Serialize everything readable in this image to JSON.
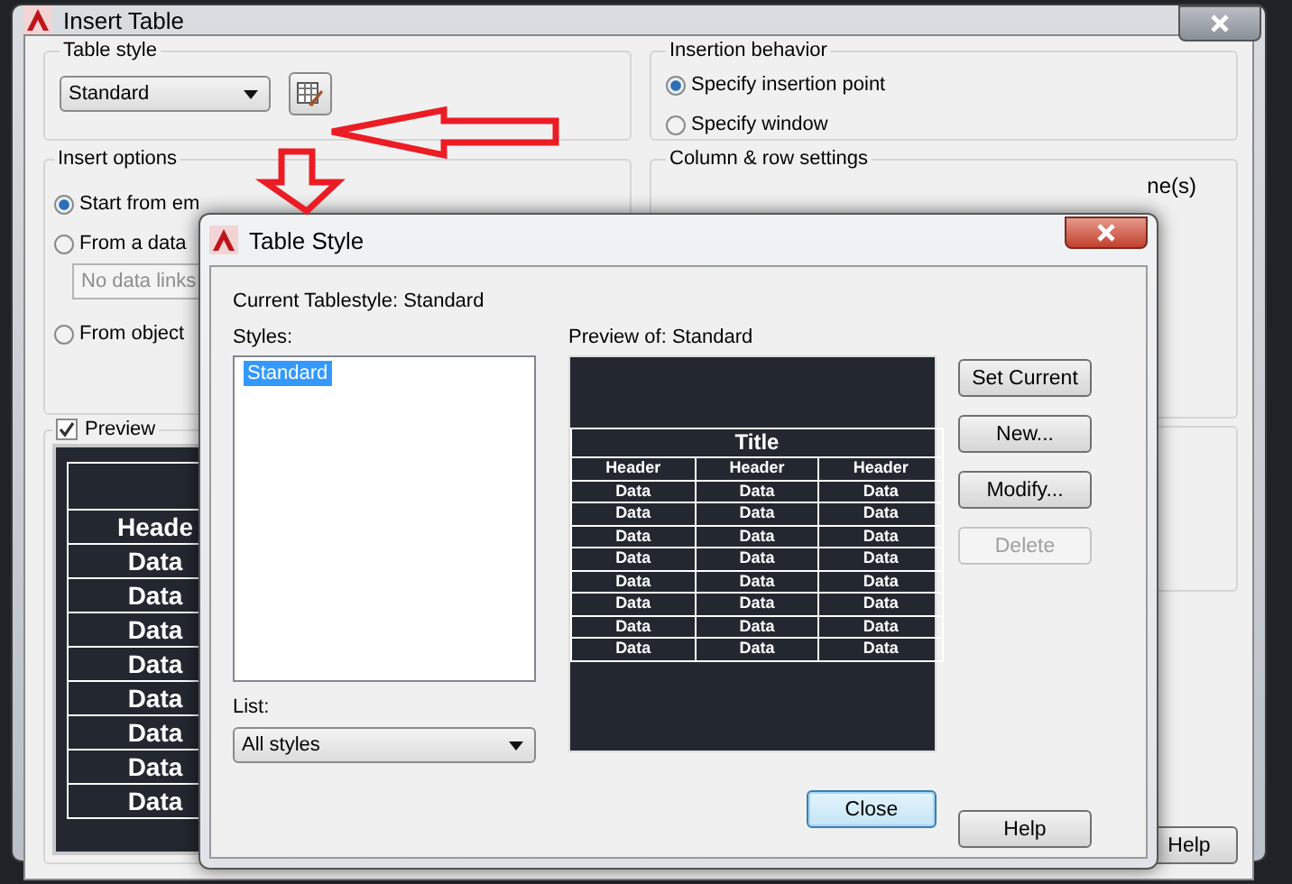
{
  "insert_table": {
    "title": "Insert Table",
    "table_style": {
      "label": "Table style",
      "value": "Standard"
    },
    "insert_options": {
      "label": "Insert options",
      "options": [
        {
          "label": "Start from em",
          "selected": true
        },
        {
          "label": "From a data",
          "selected": false
        },
        {
          "label": "From object",
          "selected": false
        }
      ],
      "data_link": {
        "value": "No data links",
        "disabled": true
      }
    },
    "preview": {
      "label": "Preview",
      "checked": true,
      "header": "Heade",
      "rows": [
        "Data",
        "Data",
        "Data",
        "Data",
        "Data",
        "Data",
        "Data",
        "Data"
      ]
    },
    "insertion_behavior": {
      "label": "Insertion behavior",
      "options": [
        {
          "label": "Specify insertion point",
          "selected": true
        },
        {
          "label": "Specify window",
          "selected": false
        }
      ]
    },
    "column_row_settings": {
      "label": "Column & row settings",
      "text_fragment": "ne(s)"
    },
    "help_button": "Help"
  },
  "table_style_dialog": {
    "title": "Table Style",
    "current": "Current Tablestyle: Standard",
    "styles_label": "Styles:",
    "styles": [
      {
        "label": "Standard",
        "selected": true
      }
    ],
    "list_label": "List:",
    "list_value": "All styles",
    "preview_label": "Preview of: Standard",
    "preview_table": {
      "title": "Title",
      "headers": [
        "Header",
        "Header",
        "Header"
      ],
      "rows": [
        [
          "Data",
          "Data",
          "Data"
        ],
        [
          "Data",
          "Data",
          "Data"
        ],
        [
          "Data",
          "Data",
          "Data"
        ],
        [
          "Data",
          "Data",
          "Data"
        ],
        [
          "Data",
          "Data",
          "Data"
        ],
        [
          "Data",
          "Data",
          "Data"
        ],
        [
          "Data",
          "Data",
          "Data"
        ],
        [
          "Data",
          "Data",
          "Data"
        ]
      ]
    },
    "side_buttons": [
      {
        "label": "Set Current",
        "disabled": false
      },
      {
        "label": "New...",
        "disabled": false
      },
      {
        "label": "Modify...",
        "disabled": false
      },
      {
        "label": "Delete",
        "disabled": true
      }
    ],
    "close_button": {
      "label": "Close",
      "default": true
    },
    "help_button": "Help"
  }
}
